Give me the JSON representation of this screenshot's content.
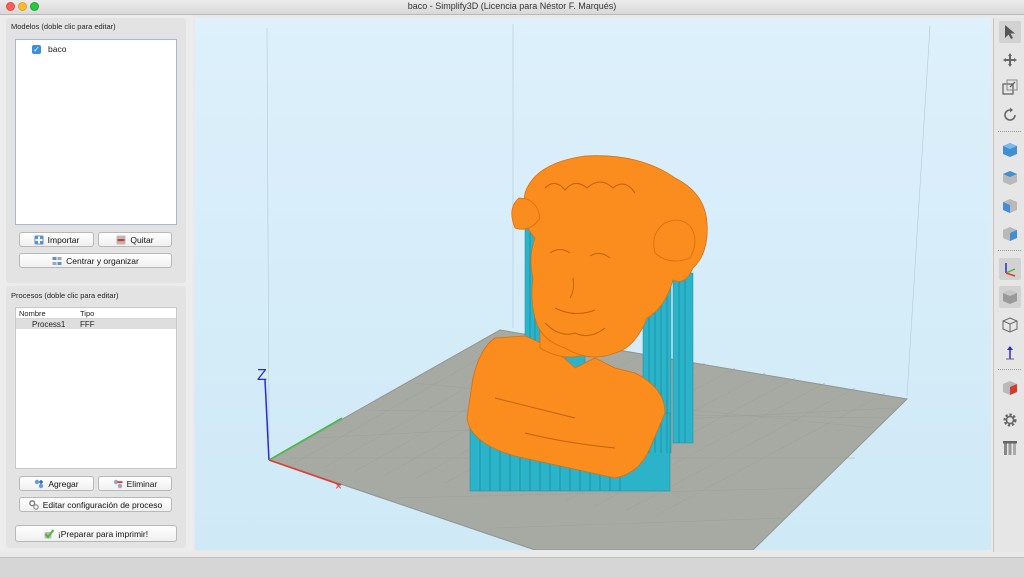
{
  "window": {
    "title": "baco - Simplify3D (Licencia para Néstor F. Marqués)"
  },
  "models": {
    "label": "Modelos (doble clic para editar)",
    "items": [
      {
        "name": "baco",
        "checked": true
      }
    ],
    "import_label": "Importar",
    "remove_label": "Quitar",
    "center_label": "Centrar y organizar"
  },
  "processes": {
    "label": "Procesos (doble clic para editar)",
    "columns": [
      "Nombre",
      "Tipo"
    ],
    "rows": [
      {
        "name": "Process1",
        "type": "FFF"
      }
    ],
    "add_label": "Agregar",
    "delete_label": "Eliminar",
    "edit_label": "Editar configuración de proceso",
    "prepare_label": "¡Preparar para imprimir!"
  },
  "viewport": {
    "axis_label": "Z",
    "colors": {
      "model": "#fb8c1e",
      "support": "#2bb4c9",
      "bed": "#a7a9a3",
      "x_axis": "#e23b2e",
      "y_axis": "#3cc23c",
      "z_axis": "#2a2ad0"
    }
  },
  "toolbar": {
    "icons": [
      "pointer-icon",
      "move-icon",
      "scale-icon",
      "rotate-icon",
      "view-default-icon",
      "view-top-icon",
      "view-front-icon",
      "view-side-icon",
      "axes-icon",
      "solid-cube-icon",
      "wireframe-cube-icon",
      "axis-arrow-icon",
      "cross-section-icon",
      "settings-gear-icon",
      "supports-icon"
    ]
  }
}
